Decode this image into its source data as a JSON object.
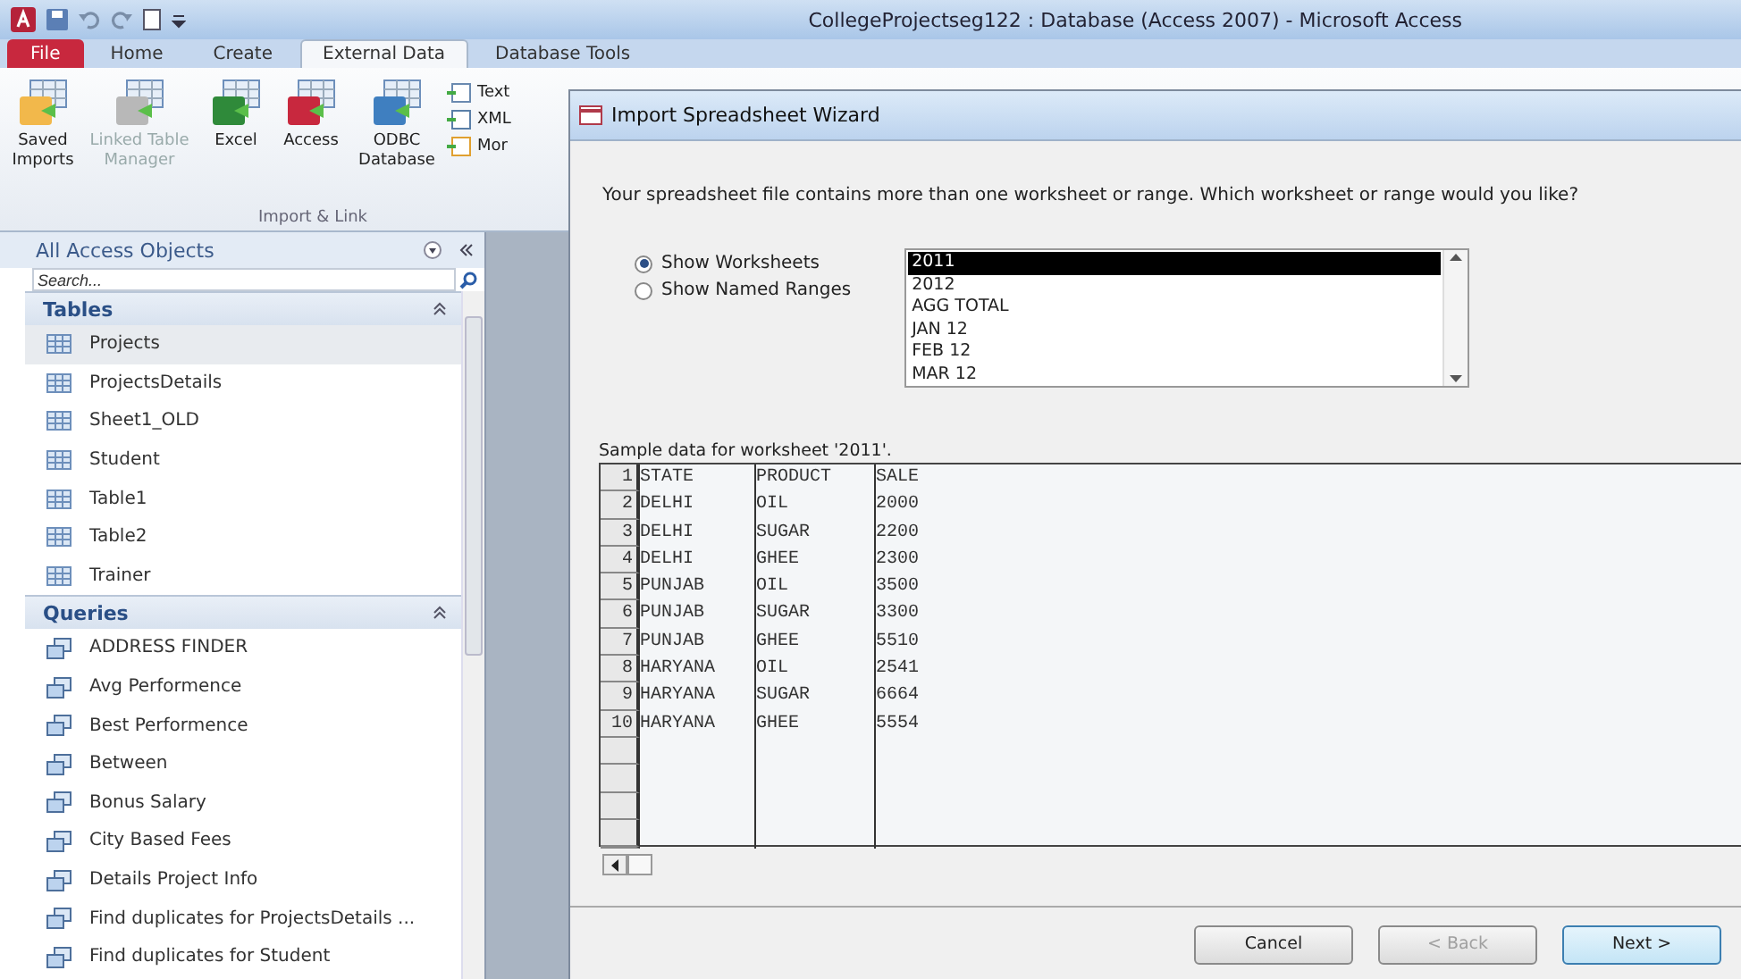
{
  "window": {
    "title": "CollegeProjectseg122 : Database (Access 2007)  -  Microsoft Access"
  },
  "ribbon": {
    "tabs": [
      {
        "label": "File",
        "kind": "file",
        "selected": false
      },
      {
        "label": "Home",
        "kind": "tab",
        "selected": false
      },
      {
        "label": "Create",
        "kind": "tab",
        "selected": false
      },
      {
        "label": "External Data",
        "kind": "tab",
        "selected": true
      },
      {
        "label": "Database Tools",
        "kind": "tab",
        "selected": false
      }
    ],
    "group": {
      "label": "Import & Link",
      "buttons": [
        {
          "label": "Saved Imports",
          "kind": "saved",
          "disabled": false
        },
        {
          "label": "Linked Table Manager",
          "kind": "linked",
          "disabled": true
        },
        {
          "label": "Excel",
          "kind": "excel",
          "disabled": false
        },
        {
          "label": "Access",
          "kind": "access",
          "disabled": false
        },
        {
          "label": "ODBC Database",
          "kind": "odbc",
          "disabled": false
        }
      ],
      "small_buttons": [
        {
          "label": "Text",
          "kind": "text"
        },
        {
          "label": "XML",
          "kind": "xml"
        },
        {
          "label": "Mor",
          "kind": "more"
        }
      ]
    }
  },
  "nav": {
    "title": "All Access Objects",
    "search": {
      "placeholder": "Search..."
    },
    "groups": [
      {
        "title": "Tables",
        "kind": "table",
        "expanded": true,
        "items": [
          {
            "label": "Projects",
            "selected": true
          },
          {
            "label": "ProjectsDetails",
            "selected": false
          },
          {
            "label": "Sheet1_OLD",
            "selected": false
          },
          {
            "label": "Student",
            "selected": false
          },
          {
            "label": "Table1",
            "selected": false
          },
          {
            "label": "Table2",
            "selected": false
          },
          {
            "label": "Trainer",
            "selected": false
          }
        ]
      },
      {
        "title": "Queries",
        "kind": "query",
        "expanded": true,
        "items": [
          {
            "label": "ADDRESS FINDER",
            "selected": false
          },
          {
            "label": "Avg Performence",
            "selected": false
          },
          {
            "label": "Best Performence",
            "selected": false
          },
          {
            "label": "Between",
            "selected": false
          },
          {
            "label": "Bonus Salary",
            "selected": false
          },
          {
            "label": "City Based Fees",
            "selected": false
          },
          {
            "label": "Details Project Info",
            "selected": false
          },
          {
            "label": "Find duplicates for ProjectsDetails ...",
            "selected": false
          },
          {
            "label": "Find duplicates for Student",
            "selected": false
          }
        ]
      }
    ]
  },
  "dialog": {
    "title": "Import Spreadsheet Wizard",
    "question": "Your spreadsheet file contains more than one worksheet or range. Which worksheet or range would you like?",
    "options": [
      {
        "label": "Show Worksheets",
        "selected": true
      },
      {
        "label": "Show Named Ranges",
        "selected": false
      }
    ],
    "sheets": [
      {
        "label": "2011",
        "selected": true
      },
      {
        "label": "2012",
        "selected": false
      },
      {
        "label": "AGG TOTAL",
        "selected": false
      },
      {
        "label": "JAN 12",
        "selected": false
      },
      {
        "label": "FEB 12",
        "selected": false
      },
      {
        "label": "MAR 12",
        "selected": false
      }
    ],
    "sample_label": "Sample data for worksheet '2011'.",
    "sample_rows": [
      {
        "number": "1",
        "cells": [
          "STATE",
          "PRODUCT",
          "SALE"
        ]
      },
      {
        "number": "2",
        "cells": [
          "DELHI",
          "OIL",
          "2000"
        ]
      },
      {
        "number": "3",
        "cells": [
          "DELHI",
          "SUGAR",
          "2200"
        ]
      },
      {
        "number": "4",
        "cells": [
          "DELHI",
          "GHEE",
          "2300"
        ]
      },
      {
        "number": "5",
        "cells": [
          "PUNJAB",
          "OIL",
          "3500"
        ]
      },
      {
        "number": "6",
        "cells": [
          "PUNJAB",
          "SUGAR",
          "3300"
        ]
      },
      {
        "number": "7",
        "cells": [
          "PUNJAB",
          "GHEE",
          "5510"
        ]
      },
      {
        "number": "8",
        "cells": [
          "HARYANA",
          "OIL",
          "2541"
        ]
      },
      {
        "number": "9",
        "cells": [
          "HARYANA",
          "SUGAR",
          "6664"
        ]
      },
      {
        "number": "10",
        "cells": [
          "HARYANA",
          "GHEE",
          "5554"
        ]
      }
    ],
    "buttons": [
      {
        "label": "Cancel",
        "disabled": false,
        "selected": false
      },
      {
        "label": "< Back",
        "disabled": true,
        "selected": false
      },
      {
        "label": "Next >",
        "disabled": false,
        "selected": true
      }
    ]
  }
}
